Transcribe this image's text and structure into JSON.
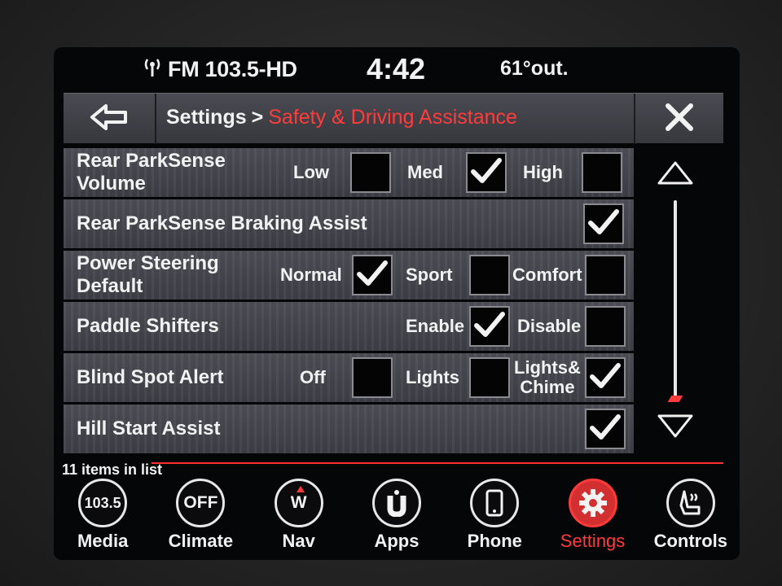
{
  "status": {
    "radio_icon": "antenna-icon",
    "radio": "FM 103.5-HD",
    "clock": "4:42",
    "temperature": "61°out."
  },
  "header": {
    "back_icon": "back-arrow-icon",
    "breadcrumb_root": "Settings",
    "breadcrumb_sep": ">",
    "breadcrumb_current": "Safety & Driving Assistance",
    "close_icon": "close-icon"
  },
  "rows": [
    {
      "label": "Rear ParkSense\nVolume",
      "options": [
        {
          "label": "Low",
          "checked": false
        },
        {
          "label": "Med",
          "checked": true
        },
        {
          "label": "High",
          "checked": false
        }
      ]
    },
    {
      "label": "Rear ParkSense Braking Assist",
      "options": [
        {
          "label": "",
          "checked": true
        }
      ]
    },
    {
      "label": "Power Steering\nDefault",
      "options": [
        {
          "label": "Normal",
          "checked": true
        },
        {
          "label": "Sport",
          "checked": false
        },
        {
          "label": "Comfort",
          "checked": false
        }
      ]
    },
    {
      "label": "Paddle Shifters",
      "options": [
        {
          "label": "Enable",
          "checked": true
        },
        {
          "label": "Disable",
          "checked": false
        }
      ]
    },
    {
      "label": "Blind Spot Alert",
      "options": [
        {
          "label": "Off",
          "checked": false
        },
        {
          "label": "Lights",
          "checked": false
        },
        {
          "label": "Lights&\nChime",
          "checked": true
        }
      ]
    },
    {
      "label": "Hill Start Assist",
      "options": [
        {
          "label": "",
          "checked": true
        }
      ]
    }
  ],
  "list_count": "11 items in list",
  "nav": [
    {
      "label": "Media",
      "icon_text": "103.5",
      "icon": "media-icon",
      "active": false
    },
    {
      "label": "Climate",
      "icon_text": "OFF",
      "icon": "climate-icon",
      "active": false
    },
    {
      "label": "Nav",
      "icon_text": "W",
      "icon": "compass-icon",
      "active": false
    },
    {
      "label": "Apps",
      "icon_text": "",
      "icon": "apps-icon",
      "active": false
    },
    {
      "label": "Phone",
      "icon_text": "",
      "icon": "phone-icon",
      "active": false
    },
    {
      "label": "Settings",
      "icon_text": "",
      "icon": "gear-icon",
      "active": true
    },
    {
      "label": "Controls",
      "icon_text": "",
      "icon": "seat-icon",
      "active": false
    }
  ],
  "colors": {
    "accent": "#ff3c3c",
    "row_bg": "#44454c",
    "text": "#f2f2f2"
  }
}
